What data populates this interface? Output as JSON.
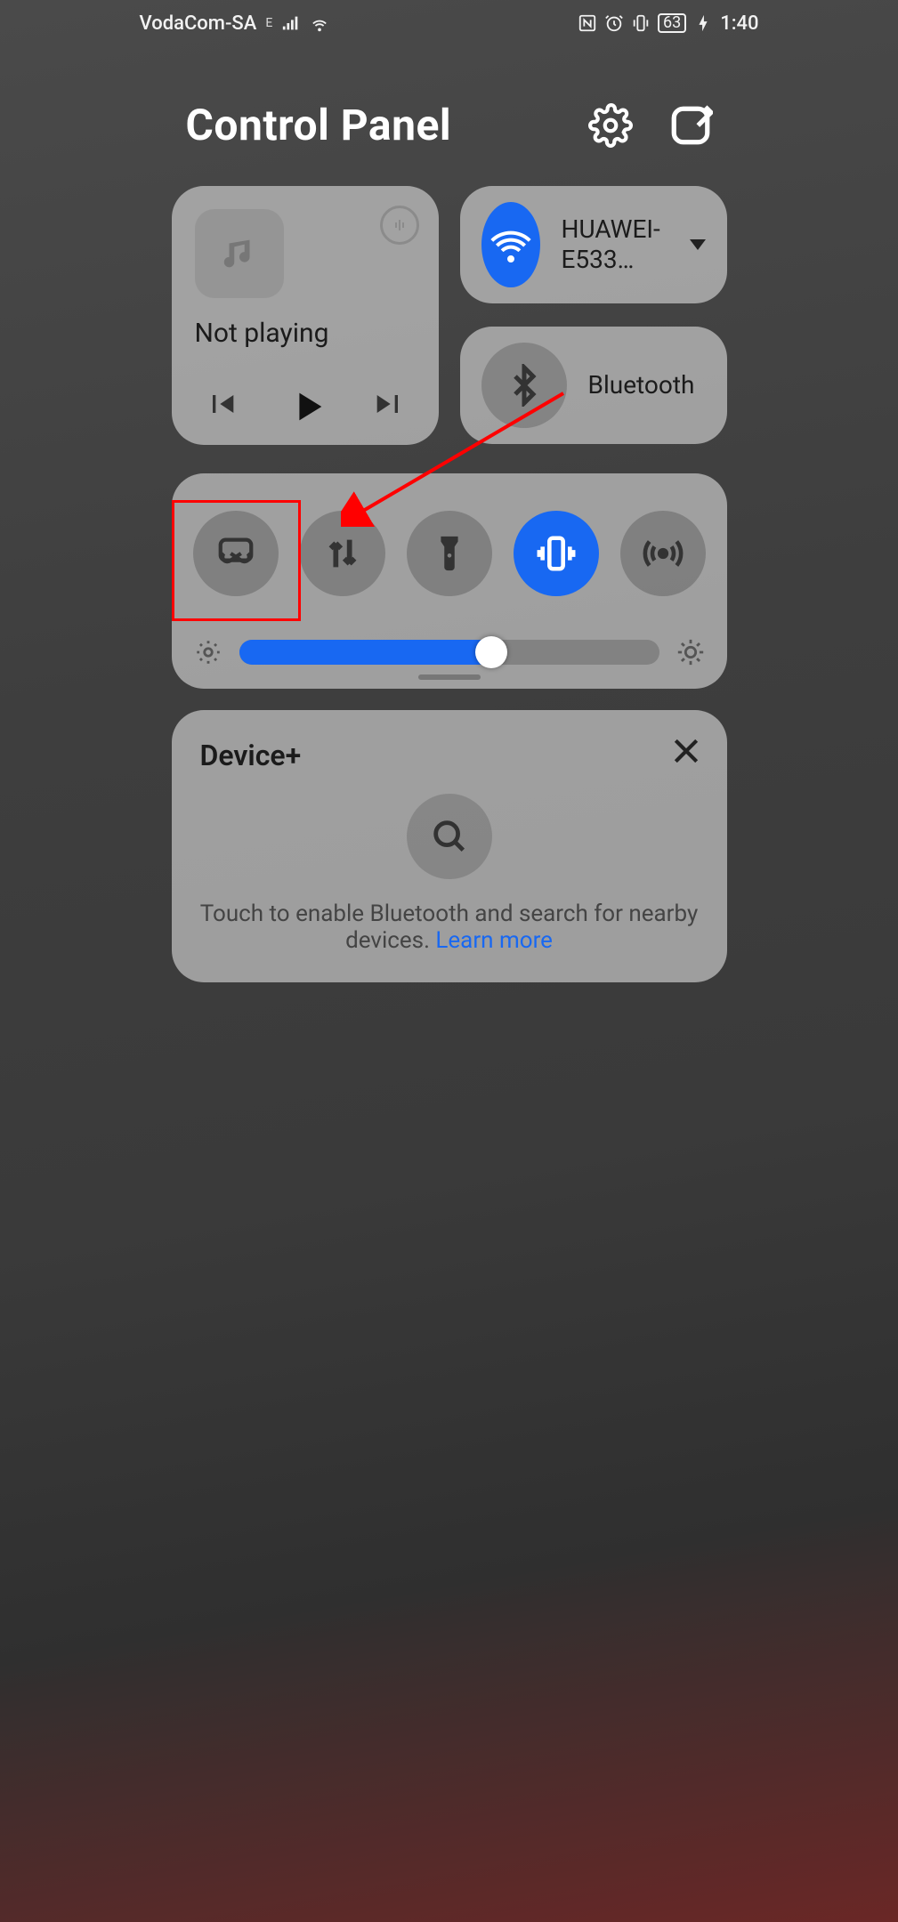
{
  "statusbar": {
    "carrier": "VodaCom-SA",
    "network": "E",
    "battery": "63",
    "time": "1:40"
  },
  "header": {
    "title": "Control Panel"
  },
  "media": {
    "status": "Not playing"
  },
  "wifi": {
    "label": "HUAWEI-E533…",
    "on": true
  },
  "bluetooth": {
    "label": "Bluetooth",
    "on": false
  },
  "toggles": {
    "screenshot": {
      "on": false
    },
    "mobiledata": {
      "on": false
    },
    "flashlight": {
      "on": false
    },
    "vibrate": {
      "on": true
    },
    "hotspot": {
      "on": false
    }
  },
  "brightness": {
    "value_percent": 60
  },
  "deviceplus": {
    "title": "Device+",
    "message": "Touch to enable Bluetooth and search for nearby devices. ",
    "link": "Learn more"
  }
}
